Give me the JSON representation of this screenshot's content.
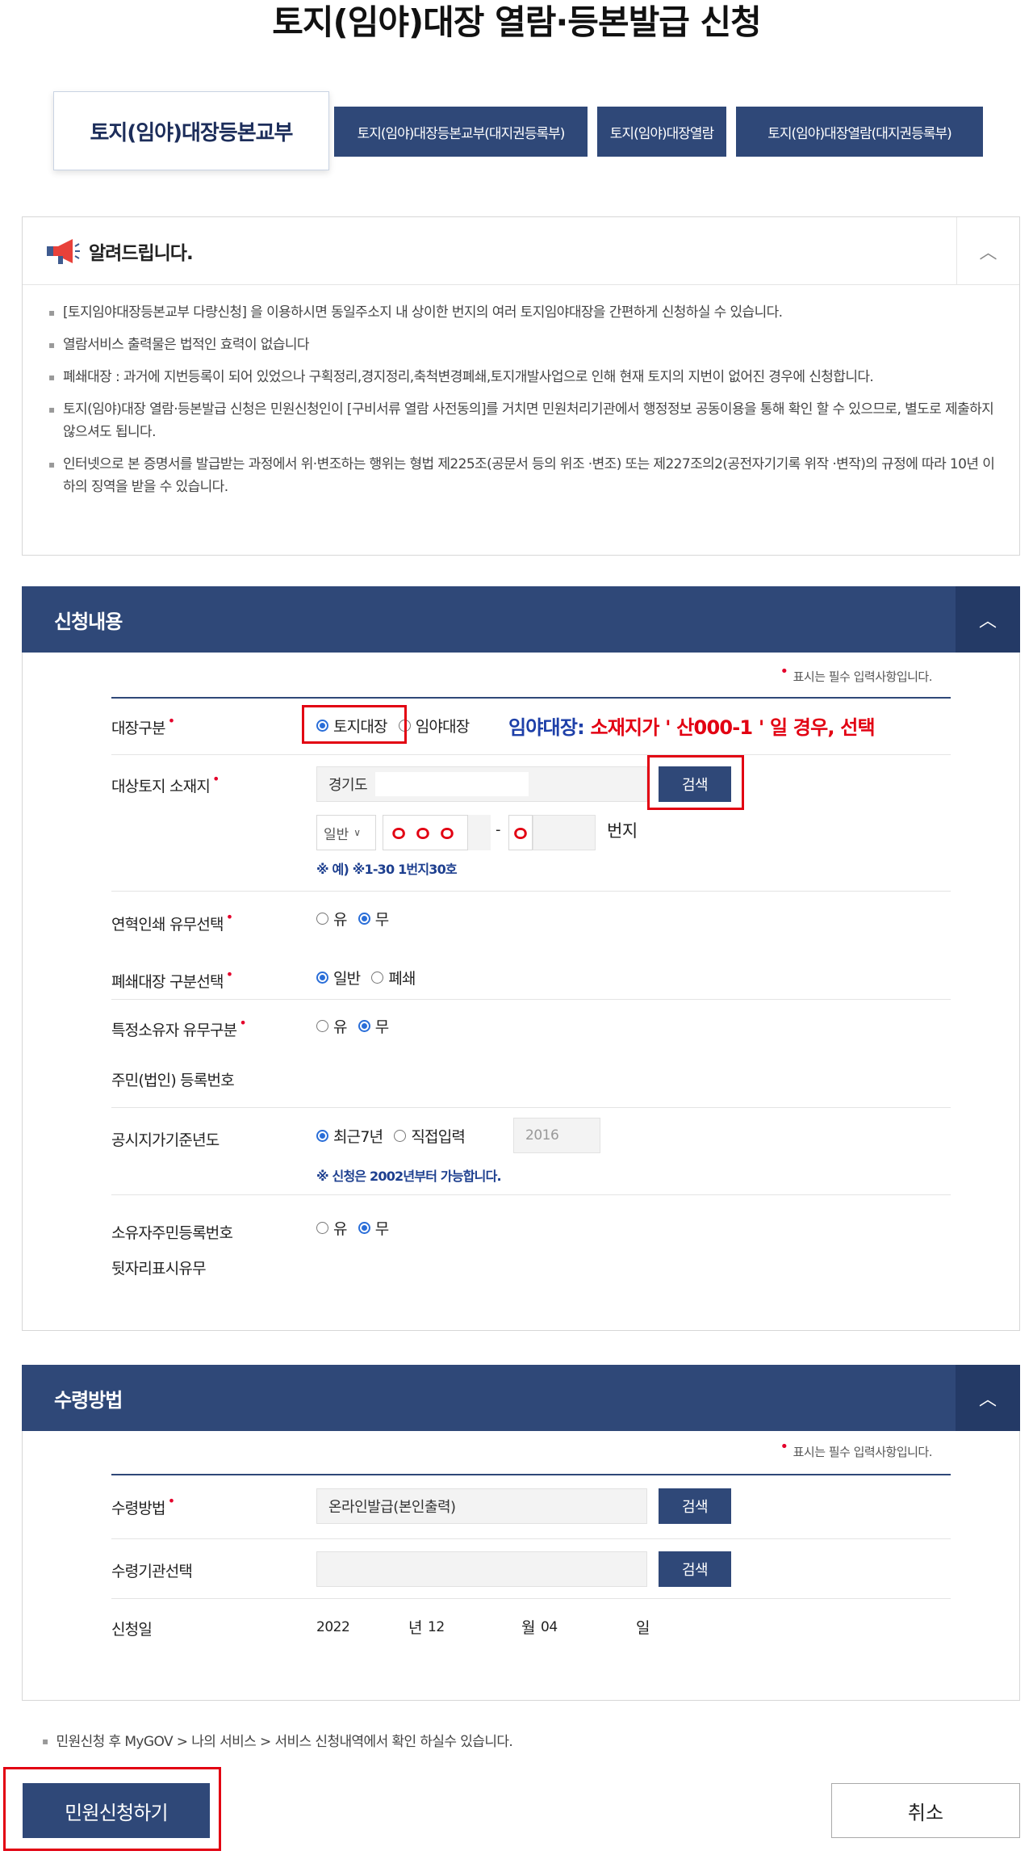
{
  "page": {
    "title": "토지(임야)대장 열람·등본발급 신청"
  },
  "tabs": [
    {
      "label": "토지(임야)대장등본교부",
      "active": true
    },
    {
      "label": "토지(임야)대장등본교부(대지권등록부)",
      "active": false
    },
    {
      "label": "토지(임야)대장열람",
      "active": false
    },
    {
      "label": "토지(임야)대장열람(대지권등록부)",
      "active": false
    }
  ],
  "notice": {
    "title": "알려드립니다.",
    "toggle": "︿",
    "items": [
      "[토지임야대장등본교부 다량신청] 을 이용하시면 동일주소지 내 상이한 번지의 여러 토지임야대장을 간편하게 신청하실 수 있습니다.",
      "열람서비스 출력물은 법적인 효력이 없습니다",
      "폐쇄대장 : 과거에 지번등록이 되어 있었으나 구획정리,경지정리,축척변경폐쇄,토지개발사업으로 인해 현재 토지의 지번이 없어진 경우에 신청합니다.",
      "토지(임야)대장 열람·등본발급 신청은 민원신청인이 [구비서류 열람 사전동의]를 거치면 민원처리기관에서 행정정보 공동이용을 통해 확인 할 수 있으므로, 별도로 제출하지 않으셔도 됩니다.",
      "인터넷으로 본 증명서를 발급받는 과정에서 위·변조하는 행위는 형법 제225조(공문서 등의 위조 ·변조) 또는 제227조의2(공전자기기록 위작 ·변작)의 규정에 따라 10년 이하의 징역을 받을 수 있습니다."
    ]
  },
  "application": {
    "title": "신청내용",
    "toggle": "︿",
    "required_note": "표시는 필수 입력사항입니다.",
    "ledger_type": {
      "label": "대장구분",
      "options": [
        "토지대장",
        "임야대장"
      ],
      "selected": "토지대장"
    },
    "annotation": {
      "part1": "임야대장: ",
      "part2": "소재지가 ' 산000-1 ' 일 경우,  선택",
      "color1": "#1d3fa8",
      "color2": "#e20012"
    },
    "location": {
      "label": "대상토지 소재지",
      "value": "경기도",
      "search_button": "검색",
      "lot_type": "일반",
      "main_number": "ㅇㅇㅇ",
      "separator": "-",
      "sub_number": "ㅇ",
      "suffix": "번지",
      "hint": "※ 예) ※1-30 1번지30호"
    },
    "history_print": {
      "label": "연혁인쇄 유무선택",
      "options": [
        "유",
        "무"
      ],
      "selected": "무"
    },
    "closed_ledger": {
      "label": "폐쇄대장 구분선택",
      "options": [
        "일반",
        "폐쇄"
      ],
      "selected": "일반"
    },
    "special_owner": {
      "label": "특정소유자 유무구분",
      "options": [
        "유",
        "무"
      ],
      "selected": "무"
    },
    "reg_number": {
      "label": "주민(법인) 등록번호"
    },
    "price_year": {
      "label": "공시지가기준년도",
      "options": [
        "최근7년",
        "직접입력"
      ],
      "selected": "최근7년",
      "year_value": "2016",
      "hint": "※ 신청은 2002년부터 가능합니다."
    },
    "owner_suffix": {
      "label_line1": "소유자주민등록번호",
      "label_line2": "뒷자리표시유무",
      "options": [
        "유",
        "무"
      ],
      "selected": "무"
    }
  },
  "receipt": {
    "title": "수령방법",
    "toggle": "︿",
    "required_note": "표시는 필수 입력사항입니다.",
    "method": {
      "label": "수령방법",
      "value": "온라인발급(본인출력)",
      "button": "검색"
    },
    "agency": {
      "label": "수령기관선택",
      "value": "",
      "button": "검색"
    },
    "date": {
      "label": "신청일",
      "year": "2022",
      "year_unit": "년",
      "month": "12",
      "month_unit": "월",
      "day": "04",
      "day_unit": "일"
    }
  },
  "footer": {
    "note": "민원신청 후 MyGOV > 나의 서비스 > 서비스 신청내역에서 확인 하실수 있습니다.",
    "submit": "민원신청하기",
    "cancel": "취소"
  },
  "colors": {
    "navy": "#2f4878",
    "highlight_red": "#e20012",
    "required_red": "#e4002b",
    "radio_blue": "#2a6ed8"
  }
}
